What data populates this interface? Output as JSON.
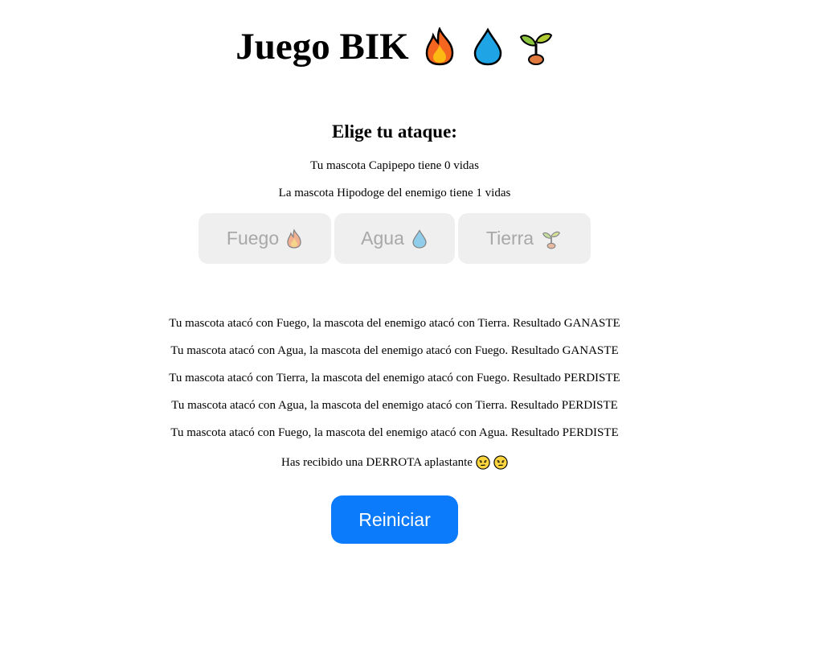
{
  "header": {
    "title": "Juego BIK",
    "icons": [
      "fire-icon",
      "droplet-icon",
      "seedling-icon"
    ]
  },
  "attack_section": {
    "heading": "Elige tu ataque:",
    "player_lives": "Tu mascota Capipepo tiene 0 vidas",
    "enemy_lives": "La mascota Hipodoge del enemigo tiene 1 vidas",
    "buttons": [
      {
        "label": "Fuego",
        "icon": "fire-icon",
        "disabled": true
      },
      {
        "label": "Agua",
        "icon": "droplet-icon",
        "disabled": true
      },
      {
        "label": "Tierra",
        "icon": "seedling-icon",
        "disabled": true
      }
    ]
  },
  "log": [
    "Tu mascota atacó con Fuego, la mascota del enemigo atacó con Tierra. Resultado GANASTE",
    "Tu mascota atacó con Agua, la mascota del enemigo atacó con Fuego. Resultado GANASTE",
    "Tu mascota atacó con Tierra, la mascota del enemigo atacó con Fuego. Resultado PERDISTE",
    "Tu mascota atacó con Agua, la mascota del enemigo atacó con Tierra. Resultado PERDISTE",
    "Tu mascota atacó con Fuego, la mascota del enemigo atacó con Agua. Resultado PERDISTE"
  ],
  "final_message": {
    "text": "Has recibido una DERROTA aplastante",
    "icons": [
      "unamused-face-icon",
      "unamused-face-icon"
    ]
  },
  "restart_button": {
    "label": "Reiniciar"
  },
  "colors": {
    "restart_bg": "#0b7bfb",
    "disabled_button_bg": "#efefef",
    "disabled_button_text": "#a8a8a8"
  }
}
